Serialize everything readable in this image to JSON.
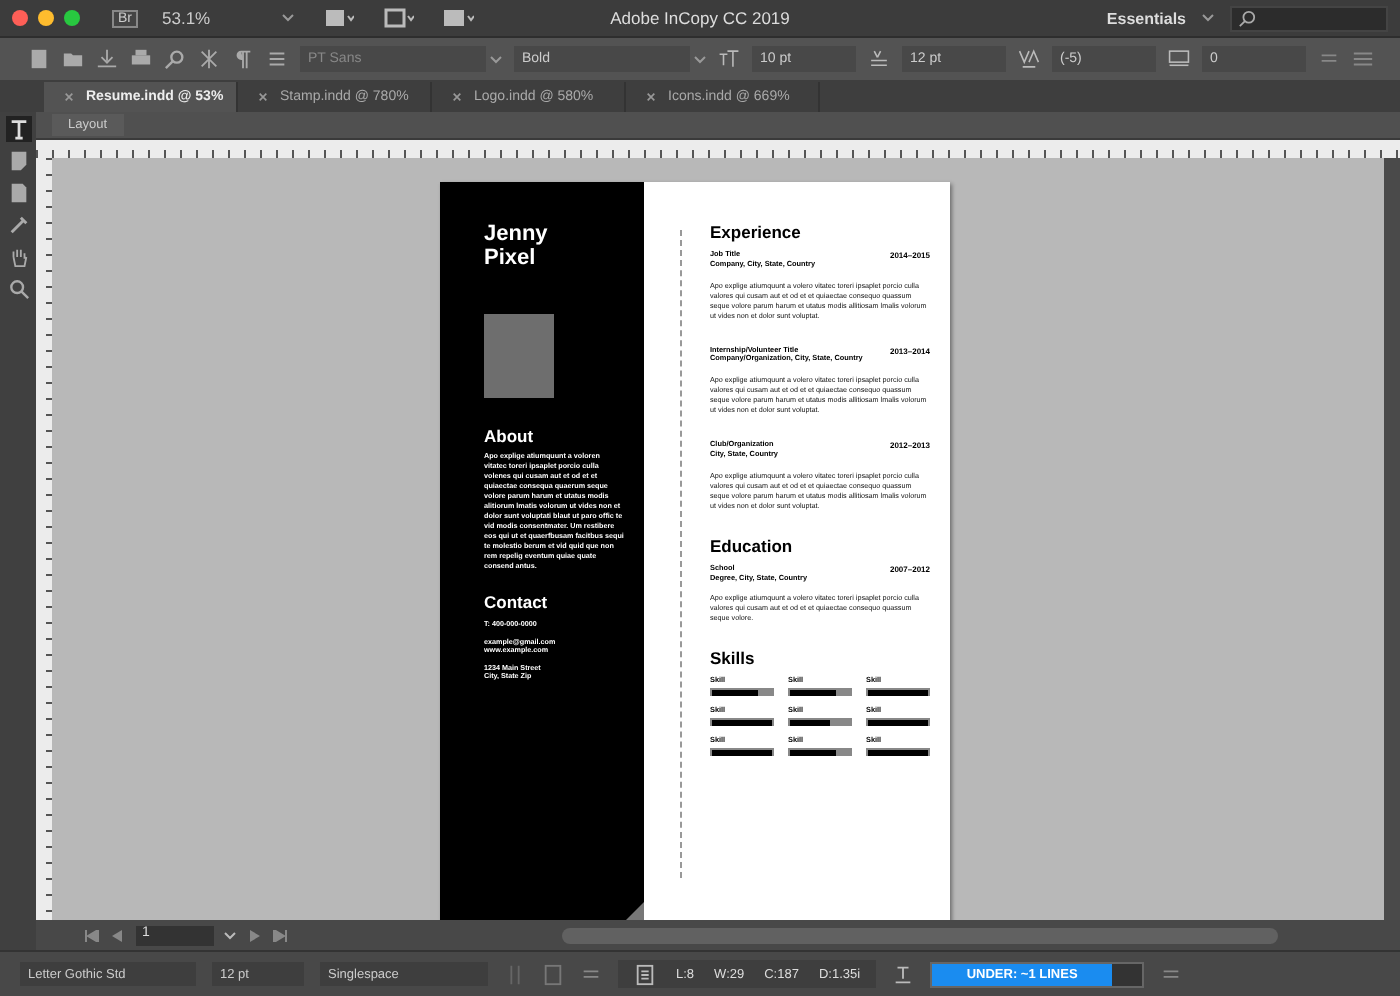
{
  "window": {
    "title": "Adobe InCopy CC 2019",
    "workspace": "Essentials",
    "app_badge": "Br",
    "zoom": "53.1%"
  },
  "toolbar": {
    "font_family": "PT Sans",
    "font_style": "Bold",
    "font_size": "10 pt",
    "leading": "12 pt",
    "kerning": "(-5)",
    "tracking": "0"
  },
  "tabs": [
    {
      "label": "Resume.indd @ 53%",
      "selected": true
    },
    {
      "label": "Stamp.indd @ 780%",
      "selected": false
    },
    {
      "label": "Logo.indd @ 580%",
      "selected": false
    },
    {
      "label": "Icons.indd @ 669%",
      "selected": false
    }
  ],
  "view_tab": "Layout",
  "tools": [
    {
      "kind": "text",
      "selected": true
    },
    {
      "kind": "note",
      "selected": false
    },
    {
      "kind": "position",
      "selected": false
    },
    {
      "kind": "eyedropper",
      "selected": false
    },
    {
      "kind": "hand",
      "selected": false
    },
    {
      "kind": "zoom",
      "selected": false
    }
  ],
  "resume": {
    "name": [
      "Jenny",
      "Pixel"
    ],
    "about": {
      "heading": "About",
      "text": "Apo explige atiumquunt a voloren vitatec toreri ipsaplet porcio culla volenes qui cusam aut et od et et quiaectae consequa quaerum seque volore parum harum et utatus modis alitiorum lmatis volorum ut vides non et dolor sunt voluptati blaut ut paro offic te vid modis consentmater. Um restibere eos qui ut et quaerfbusam facitbus sequi te molestio berum et vid quid que non rem repelig eventum quiae quate consend antus."
    },
    "contact": {
      "heading": "Contact",
      "blocks": [
        {
          "lines": [
            "T: 400-000-0000"
          ]
        },
        {
          "lines": [
            "example@gmail.com",
            "www.example.com"
          ]
        },
        {
          "lines": [
            "1234 Main Street",
            "City, State Zip"
          ]
        }
      ]
    },
    "sections": [
      {
        "heading": "Experience",
        "entries": [
          {
            "title": "Job Title",
            "subtitle": "Company, City, State, Country",
            "dates": "2014–2015",
            "text": "Apo explige atiumquunt a volero vitatec toreri ipsaplet porcio culla valores qui cusam aut et od et et quiaectae consequo quassum seque volore parum harum et utatus modis allitiosam lmalis volorum ut vides non et dolor sunt voluptat."
          },
          {
            "title": "Internship/Volunteer Title",
            "subtitle": "Company/Organization, City, State, Country",
            "dates": "2013–2014",
            "text": "Apo explige atiumquunt a volero vitatec toreri ipsaplet porcio culla valores qui cusam aut et od et et quiaectae consequo quassum seque volore parum harum et utatus modis allitiosam lmalis volorum ut vides non et dolor sunt voluptat."
          },
          {
            "title": "Club/Organization",
            "subtitle": "City, State, Country",
            "dates": "2012–2013",
            "text": "Apo explige atiumquunt a volero vitatec toreri ipsaplet porcio culla valores qui cusam aut et od et et quiaectae consequo quassum seque volore parum harum et utatus modis allitiosam lmalis volorum ut vides non et dolor sunt voluptat."
          }
        ]
      },
      {
        "heading": "Education",
        "entries": [
          {
            "title": "School",
            "subtitle": "Degree, City, State, Country",
            "dates": "2007–2012",
            "text": "Apo explige atiumquunt a volero vitatec toreri ipsaplet porcio culla valores qui cusam aut et od et et quiaectae consequo quassum seque volore."
          }
        ]
      }
    ],
    "skills": {
      "heading": "Skills",
      "items": [
        {
          "label": "Skill",
          "level": 0.78
        },
        {
          "label": "Skill",
          "level": 0.78
        },
        {
          "label": "Skill",
          "level": 1
        },
        {
          "label": "Skill",
          "level": 1
        },
        {
          "label": "Skill",
          "level": 0.65
        },
        {
          "label": "Skill",
          "level": 1
        },
        {
          "label": "Skill",
          "level": 1
        },
        {
          "label": "Skill",
          "level": 0.75
        },
        {
          "label": "Skill",
          "level": 1
        }
      ]
    }
  },
  "navigation": {
    "page": "1"
  },
  "status_bar": {
    "font": "Letter Gothic Std",
    "size": "12 pt",
    "spacing": "Singlespace",
    "lines": "L:8",
    "words": "W:29",
    "chars": "C:187",
    "depth": "D:1.35i",
    "copyfit": {
      "label": "UNDER: ~1 LINES",
      "level": 0.86
    }
  }
}
